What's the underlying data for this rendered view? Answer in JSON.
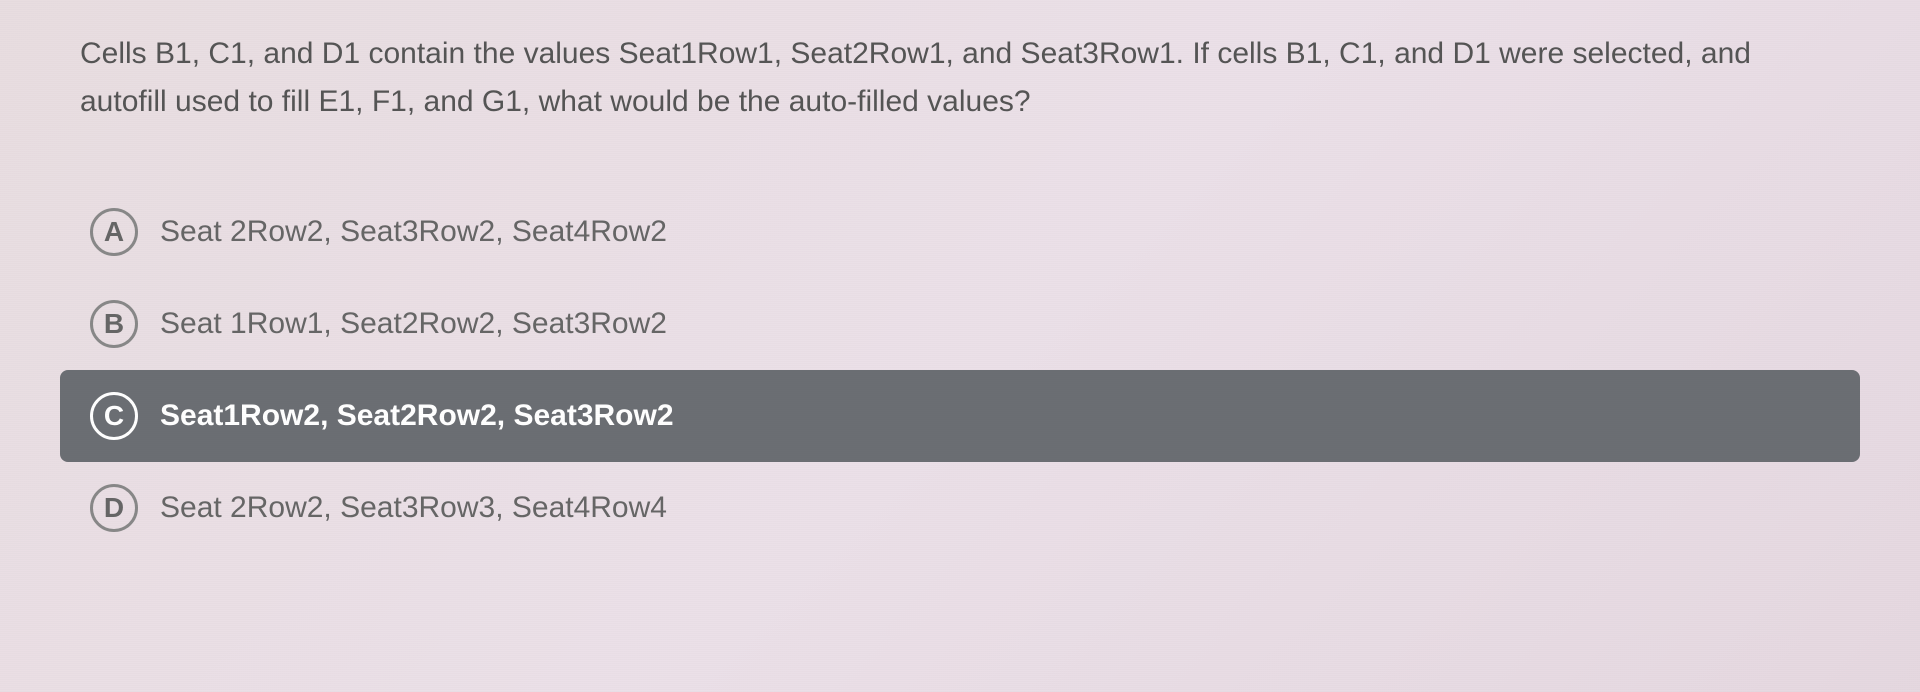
{
  "question": {
    "text": "Cells B1, C1, and D1 contain the values Seat1Row1, Seat2Row1, and Seat3Row1. If cells B1, C1, and D1 were selected, and autofill used to fill E1, F1, and G1, what would be the auto-filled values?"
  },
  "options": [
    {
      "letter": "A",
      "text": "Seat 2Row2, Seat3Row2, Seat4Row2",
      "selected": false
    },
    {
      "letter": "B",
      "text": "Seat 1Row1, Seat2Row2, Seat3Row2",
      "selected": false
    },
    {
      "letter": "C",
      "text": "Seat1Row2, Seat2Row2, Seat3Row2",
      "selected": true
    },
    {
      "letter": "D",
      "text": "Seat 2Row2, Seat3Row3, Seat4Row4",
      "selected": false
    }
  ]
}
